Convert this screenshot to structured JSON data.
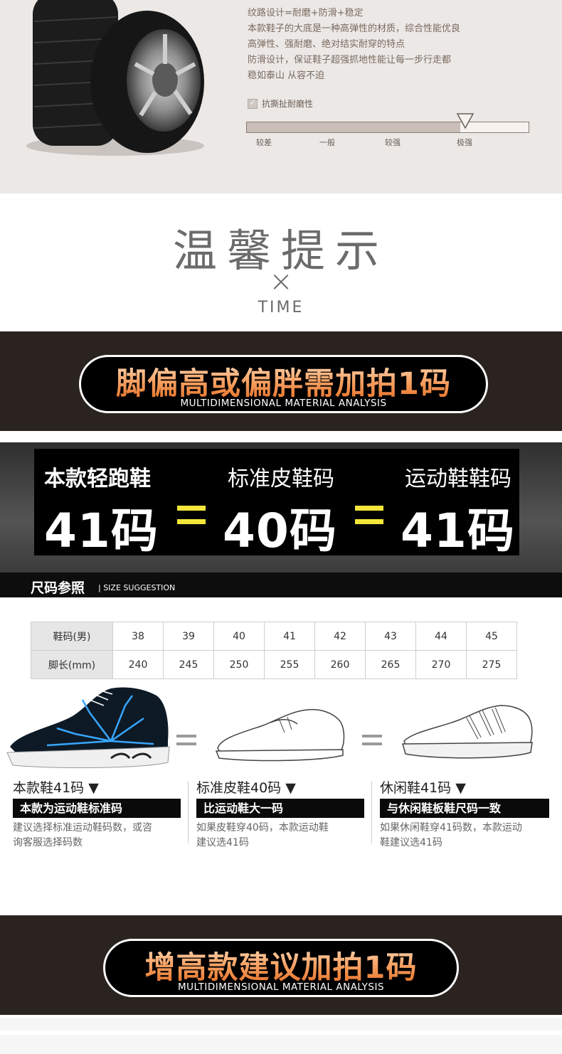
{
  "tire_section": {
    "lines": [
      "纹路设计=耐磨+防滑+稳定",
      "本款鞋子的大底是一种高弹性的材质，综合性能优良",
      "高弹性、强耐磨、绝对结实耐穿的特点",
      "防滑设计，保证鞋子超强抓地性能让每一步行走都",
      "稳如泰山 从容不迫"
    ],
    "check_label": "抗撕扯耐磨性",
    "scale_labels": [
      "较差",
      "一般",
      "较强",
      "极强"
    ],
    "rating_level": "极强"
  },
  "tips": {
    "title": "温馨提示",
    "x": "×",
    "time": "TIME"
  },
  "banner1": {
    "title": "脚偏高或偏胖需加拍1码",
    "subtitle": "MULTIDIMENSIONAL MATERIAL ANALYSIS"
  },
  "size_equation": {
    "items": [
      {
        "label": "本款轻跑鞋",
        "value": "41码"
      },
      {
        "label": "标准皮鞋码",
        "value": "40码"
      },
      {
        "label": "运动鞋鞋码",
        "value": "41码"
      }
    ]
  },
  "size_ref": {
    "title": "尺码参照",
    "subtitle": "| SIZE SUGGESTION"
  },
  "size_table": {
    "row1_label": "鞋码(男)",
    "row2_label": "脚长(mm)",
    "sizes": [
      "38",
      "39",
      "40",
      "41",
      "42",
      "43",
      "44",
      "45"
    ],
    "lengths": [
      "240",
      "245",
      "250",
      "255",
      "260",
      "265",
      "270",
      "275"
    ]
  },
  "shoes": [
    {
      "label": "本款鞋41码 ▼",
      "tag": "本款为运动鞋标准码",
      "note1": "建议选择标准运动鞋码数，或咨",
      "note2": "询客服选择码数"
    },
    {
      "label": "标准皮鞋40码 ▼",
      "tag": "比运动鞋大一码",
      "note1": "如果皮鞋穿40码，本款运动鞋",
      "note2": "建议选41码"
    },
    {
      "label": "休闲鞋41码 ▼",
      "tag": "与休闲鞋板鞋尺码一致",
      "note1": "如果休闲鞋穿41码数，本款运动",
      "note2": "鞋建议选41码"
    }
  ],
  "banner2": {
    "title": "增高款建议加拍1码",
    "subtitle": "MULTIDIMENSIONAL MATERIAL ANALYSIS"
  },
  "colors": {
    "banner_bg": "#2b2320",
    "title_gradient_top": "#ffe1c4",
    "title_gradient_bottom": "#e46a1e",
    "equals_yellow": "#f3e63a"
  }
}
